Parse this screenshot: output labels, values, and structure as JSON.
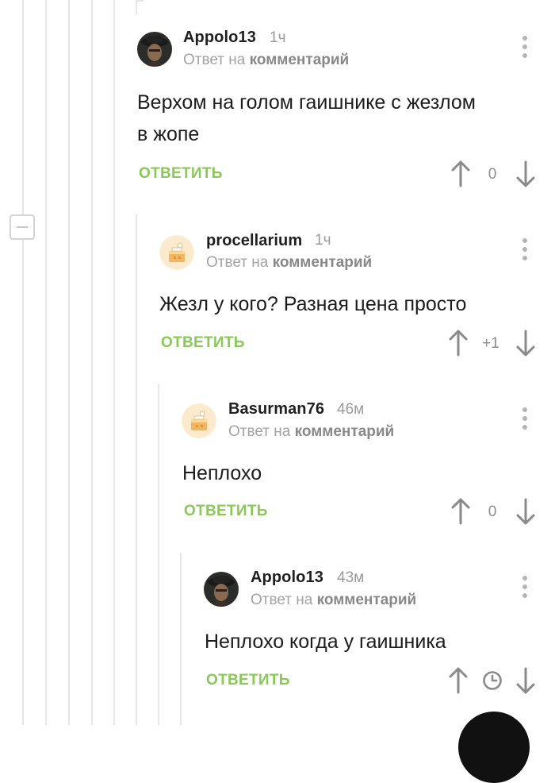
{
  "thread": {
    "collapse_icon": "minus-square-icon",
    "comments": [
      {
        "author": "Appolo13",
        "time": "1ч",
        "reply_prefix": "Ответ на",
        "reply_target": "комментарий",
        "text_lines": [
          "Верхом на голом гаишнике с жезлом",
          "в жопе"
        ],
        "reply_label": "ОТВЕТИТЬ",
        "score": "0",
        "avatar": "man-hat-avatar"
      },
      {
        "author": "procellarium",
        "time": "1ч",
        "reply_prefix": "Ответ на",
        "reply_target": "комментарий",
        "text_lines": [
          "Жезл у кого? Разная цена просто"
        ],
        "reply_label": "ОТВЕТИТЬ",
        "score": "+1",
        "avatar": "default-cake-avatar"
      },
      {
        "author": "Basurman76",
        "time": "46м",
        "reply_prefix": "Ответ на",
        "reply_target": "комментарий",
        "text_lines": [
          "Неплохо"
        ],
        "reply_label": "ОТВЕТИТЬ",
        "score": "0",
        "avatar": "default-cake-avatar"
      },
      {
        "author": "Appolo13",
        "time": "43м",
        "reply_prefix": "Ответ на",
        "reply_target": "комментарий",
        "text_lines": [
          "Неплохо когда у гаишника"
        ],
        "reply_label": "ОТВЕТИТЬ",
        "score_icon": "clock-icon",
        "avatar": "man-hat-avatar"
      }
    ]
  },
  "colors": {
    "accent_green": "#8ac858",
    "thread_line": "#e6e6e6",
    "muted_text": "#9a9a9a"
  }
}
